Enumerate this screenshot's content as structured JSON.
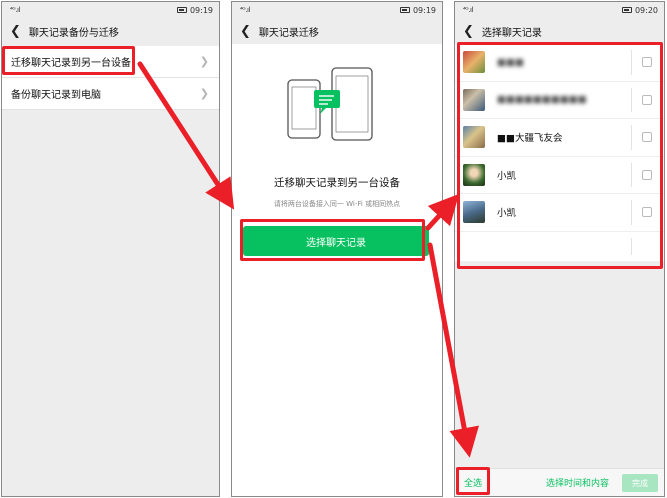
{
  "phone1": {
    "status": {
      "left": "⁴ᴳ.ıl",
      "time": "09:19"
    },
    "title": "聊天记录备份与迁移",
    "items": [
      {
        "label": "迁移聊天记录到另一台设备"
      },
      {
        "label": "备份聊天记录到电脑"
      }
    ]
  },
  "phone2": {
    "status": {
      "left": "⁴ᴳ.ıl",
      "time": "09:19"
    },
    "title": "聊天记录迁移",
    "heading": "迁移聊天记录到另一台设备",
    "subtext": "请将两台设备接入同一 Wi-Fi 或相同热点",
    "button_label": "选择聊天记录"
  },
  "phone3": {
    "status": {
      "left": "⁴ᴳ.ıl",
      "time": "09:20"
    },
    "title": "选择聊天记录",
    "chats": [
      {
        "name": "■■■",
        "blurred": true
      },
      {
        "name": "■■■■■■■■■■",
        "blurred": true
      },
      {
        "name": "■■大疆飞友会",
        "blurred": false
      },
      {
        "name": "小凯",
        "blurred": false
      },
      {
        "name": "小凯",
        "blurred": false
      }
    ],
    "select_all": "全选",
    "select_by_time": "选择时间和内容",
    "confirm": "完成"
  },
  "colors": {
    "accent_green": "#07c160",
    "annotation_red": "#ea1f27"
  }
}
